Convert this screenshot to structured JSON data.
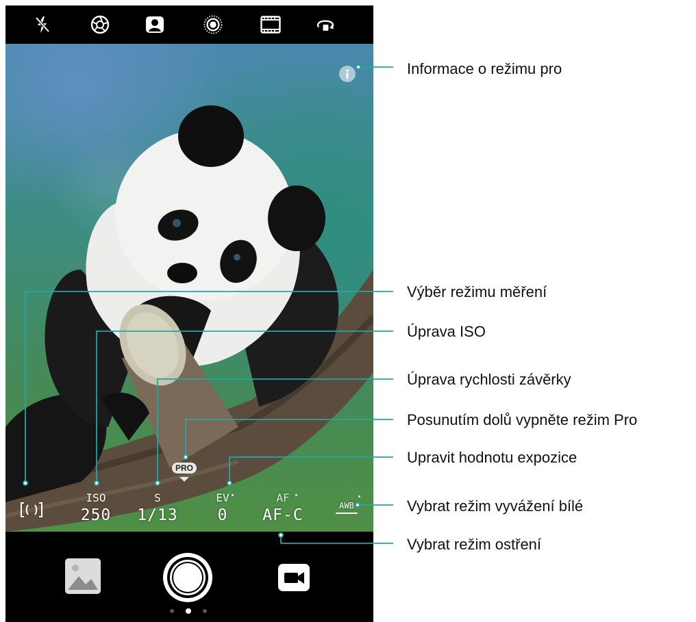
{
  "top_bar": {
    "icons": [
      "flash-off-icon",
      "aperture-icon",
      "portrait-icon",
      "live-photo-icon",
      "film-icon",
      "flip-camera-icon"
    ]
  },
  "pro_controls": {
    "metering": {
      "icon": "metering-mode-icon"
    },
    "iso": {
      "label": "ISO",
      "value": "250"
    },
    "shutter": {
      "label": "S",
      "value": "1/13"
    },
    "ev": {
      "label": "EV",
      "value": "0"
    },
    "af": {
      "label": "AF",
      "value": "AF-C"
    },
    "awb": {
      "label": "AWB"
    },
    "pro_badge": "PRO"
  },
  "bottom_bar": {
    "gallery_icon": "gallery-icon",
    "shutter_icon": "shutter-button",
    "video_icon": "video-camera-icon",
    "page_dots": 3,
    "active_dot": 1
  },
  "callouts": {
    "info": "Informace o režimu pro",
    "metering": "Výběr režimu měření",
    "iso": "Úprava ISO",
    "shutter": "Úprava rychlosti závěrky",
    "exit_pro": "Posunutím dolů vypněte režim Pro",
    "ev": "Upravit hodnotu expozice",
    "awb": "Vybrat režim vyvážení bílé",
    "af": "Vybrat režim ostření"
  },
  "colors": {
    "callout_line": "#1fa9a4",
    "bar_background": "#000000",
    "overlay_text": "#ffffff"
  }
}
